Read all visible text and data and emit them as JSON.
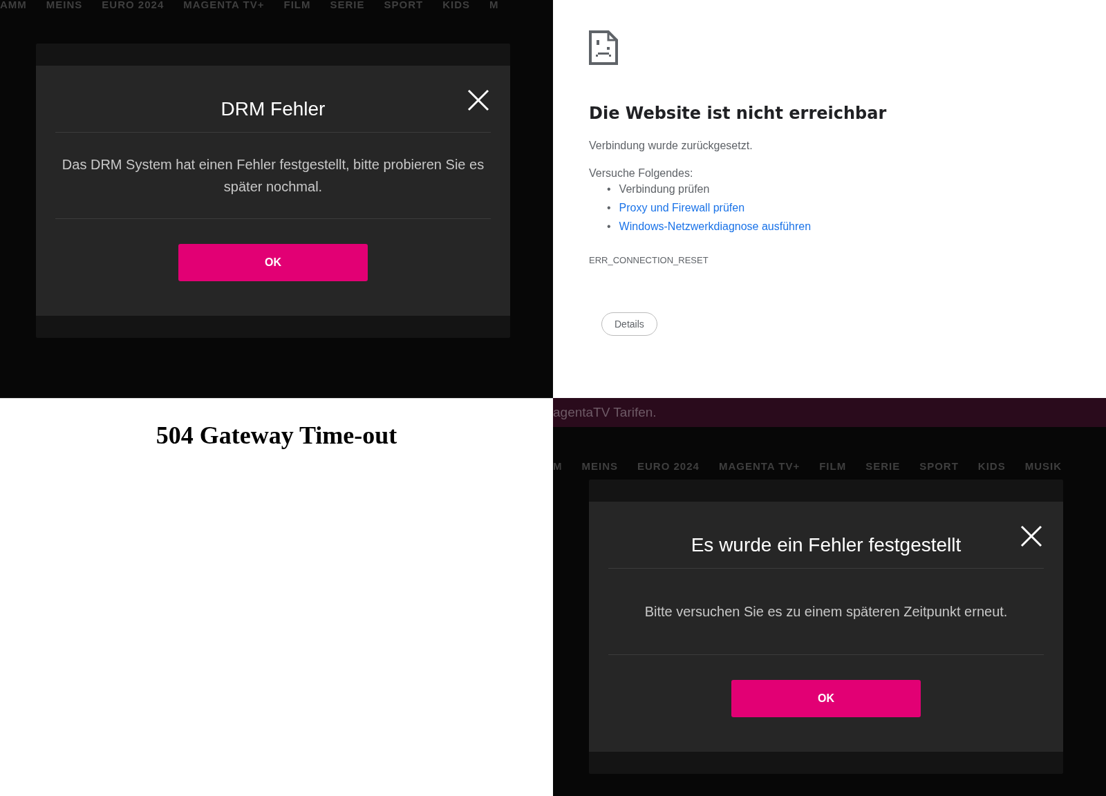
{
  "panels": [
    {
      "kind": "magenta_modal",
      "nav": [
        "AMM",
        "MEINS",
        "EURO 2024",
        "MAGENTA TV+",
        "FILM",
        "SERIE",
        "SPORT",
        "KIDS",
        "M"
      ],
      "modal": {
        "title": "DRM Fehler",
        "message": "Das DRM System hat einen Fehler festgestellt, bitte probieren Sie es später nochmal.",
        "button": "OK"
      }
    },
    {
      "kind": "browser_error",
      "heading": "Die Website ist nicht erreichbar",
      "subtitle": "Verbindung wurde zurückgesetzt.",
      "suggestions_title": "Versuche Folgendes:",
      "suggestions": [
        {
          "marker": "•",
          "text": "Verbindung prüfen",
          "kind": "text"
        },
        {
          "marker": "•",
          "text": "Proxy und Firewall prüfen",
          "kind": "link"
        },
        {
          "marker": "•",
          "text": "Windows-Netzwerkdiagnose ausführen",
          "kind": "link"
        }
      ],
      "error_code": "ERR_CONNECTION_RESET",
      "button": "Details"
    },
    {
      "kind": "gateway_error",
      "title": "504 Gateway Time-out"
    },
    {
      "kind": "magenta_modal",
      "banner": "agentaTV Tarifen.",
      "nav": [
        "M",
        "MEINS",
        "EURO 2024",
        "MAGENTA TV+",
        "FILM",
        "SERIE",
        "SPORT",
        "KIDS",
        "MUSIK"
      ],
      "modal": {
        "title": "Es wurde ein Fehler festgestellt",
        "message": "Bitte versuchen Sie es zu einem späteren Zeitpunkt erneut.",
        "button": "OK"
      }
    }
  ]
}
